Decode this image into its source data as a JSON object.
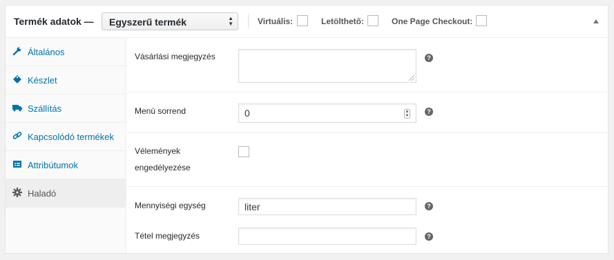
{
  "header": {
    "title": "Termék adatok —",
    "product_type": "Egyszerű termék",
    "virtual_label": "Virtuális:",
    "downloadable_label": "Letölthető:",
    "opc_label": "One Page Checkout:"
  },
  "sidebar": {
    "items": [
      {
        "label": "Általános",
        "icon": "wrench-icon"
      },
      {
        "label": "Készlet",
        "icon": "tag-icon"
      },
      {
        "label": "Szállítás",
        "icon": "truck-icon"
      },
      {
        "label": "Kapcsolódó termékek",
        "icon": "link-icon"
      },
      {
        "label": "Attribútumok",
        "icon": "list-icon"
      },
      {
        "label": "Haladó",
        "icon": "gear-icon"
      }
    ],
    "active_index": 5
  },
  "fields": {
    "purchase_note": {
      "label": "Vásárlási megjegyzés",
      "value": ""
    },
    "menu_order": {
      "label": "Menü sorrend",
      "value": "0"
    },
    "reviews": {
      "label_line1": "Vélemények",
      "label_line2": "engedélyezése",
      "checked": false
    },
    "unit": {
      "label": "Mennyiségi egység",
      "value": "liter"
    },
    "item_note": {
      "label": "Tétel megjegyzés",
      "value": ""
    }
  },
  "help_glyph": "?",
  "colors": {
    "link": "#0073aa",
    "active_tab_bg": "#eeeeee",
    "help_bg": "#666666"
  }
}
